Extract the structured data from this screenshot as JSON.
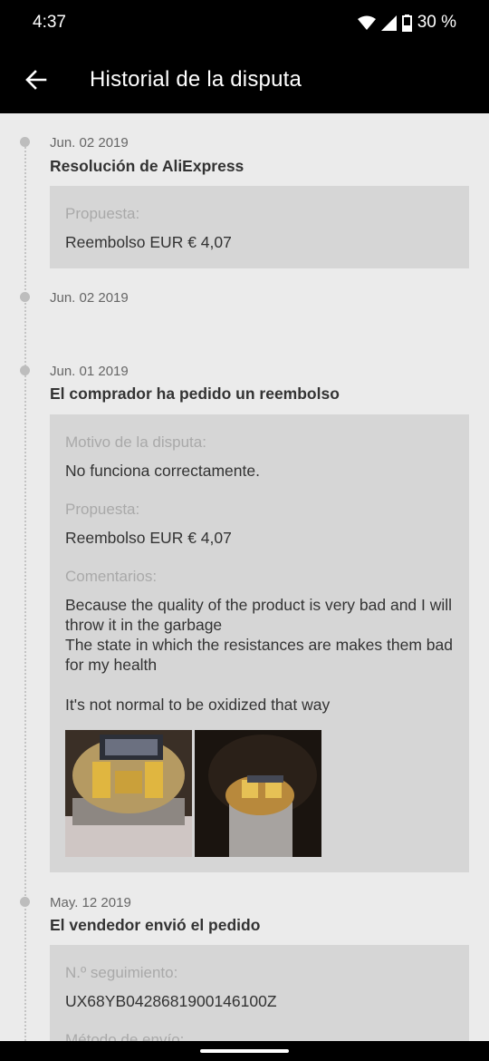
{
  "status": {
    "time": "4:37",
    "battery": "30 %"
  },
  "header": {
    "title": "Historial de la disputa"
  },
  "events": [
    {
      "date": "Jun. 02 2019",
      "title": "Resolución de AliExpress",
      "fields": [
        {
          "label": "Propuesta:",
          "value": "Reembolso EUR € 4,07"
        }
      ]
    },
    {
      "date": "Jun. 02 2019"
    },
    {
      "date": "Jun. 01 2019",
      "title": "El comprador ha pedido un reembolso",
      "fields": [
        {
          "label": "Motivo de la disputa:",
          "value": "No funciona correctamente."
        },
        {
          "label": "Propuesta:",
          "value": "Reembolso EUR € 4,07"
        },
        {
          "label": "Comentarios:",
          "value": "Because the quality of the product is very bad and I will throw it in the garbage\nThe state in which the resistances are makes them bad for my health\n\nIt's not normal to be oxidized that way"
        }
      ]
    },
    {
      "date": "May. 12 2019",
      "title": "El vendedor envió el pedido",
      "fields": [
        {
          "label": "N.º seguimiento:",
          "value": "UX68YB0428681900146100Z"
        },
        {
          "label": "Método de envío:",
          "value": ""
        }
      ]
    }
  ],
  "colors": {
    "bar": "#000000",
    "background": "#ebebeb",
    "card": "#d6d6d6"
  }
}
